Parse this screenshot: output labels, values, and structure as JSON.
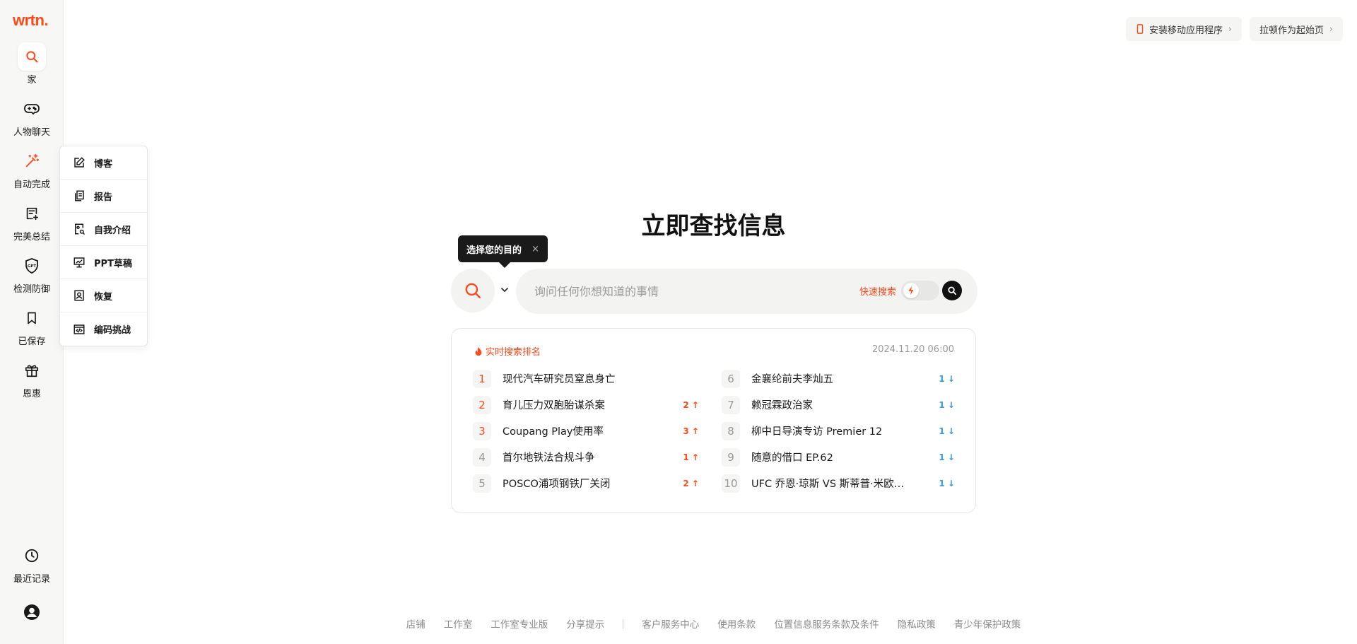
{
  "logo": "wrtn.",
  "sidebar": {
    "items": [
      {
        "label": "家",
        "icon": "search-icon"
      },
      {
        "label": "人物聊天",
        "icon": "gamepad-icon"
      },
      {
        "label": "自动完成",
        "icon": "magic-wand-icon"
      },
      {
        "label": "完美总结",
        "icon": "document-plus-icon"
      },
      {
        "label": "检测防御",
        "icon": "gpt-shield-icon"
      },
      {
        "label": "已保存",
        "icon": "bookmark-icon"
      },
      {
        "label": "恩惠",
        "icon": "gift-icon"
      }
    ],
    "recent_label": "最近记录",
    "recent_icon": "clock-icon",
    "profile_icon": "user-circle-icon"
  },
  "dropdown": {
    "items": [
      {
        "label": "博客",
        "icon": "edit-icon"
      },
      {
        "label": "报告",
        "icon": "copy-icon"
      },
      {
        "label": "自我介绍",
        "icon": "profile-doc-icon"
      },
      {
        "label": "PPT草稿",
        "icon": "presentation-icon"
      },
      {
        "label": "恢复",
        "icon": "id-card-icon"
      },
      {
        "label": "编码挑战",
        "icon": "code-window-icon"
      }
    ]
  },
  "top_buttons": {
    "install_app": "安装移动应用程序",
    "set_homepage": "拉顿作为起始页"
  },
  "main": {
    "title": "立即查找信息",
    "tooltip": "选择您的目的",
    "tooltip_close": "×",
    "search_placeholder": "询问任何你想知道的事情",
    "quick_search_label": "快速搜索"
  },
  "ranking": {
    "title": "实时搜索排名",
    "date": "2024.11.20 06:00",
    "left": [
      {
        "rank": "1",
        "title": "现代汽车研究员窒息身亡",
        "change": "",
        "dir": ""
      },
      {
        "rank": "2",
        "title": "育儿压力双胞胎谋杀案",
        "change": "2 ↑",
        "dir": "up"
      },
      {
        "rank": "3",
        "title": "Coupang Play使用率",
        "change": "3 ↑",
        "dir": "up"
      },
      {
        "rank": "4",
        "title": "首尔地铁法合规斗争",
        "change": "1 ↑",
        "dir": "up"
      },
      {
        "rank": "5",
        "title": "POSCO浦项钢铁厂关闭",
        "change": "2 ↑",
        "dir": "up"
      }
    ],
    "right": [
      {
        "rank": "6",
        "title": "金襄纶前夫李灿五",
        "change": "1 ↓",
        "dir": "down"
      },
      {
        "rank": "7",
        "title": "赖冠霖政治家",
        "change": "1 ↓",
        "dir": "down"
      },
      {
        "rank": "8",
        "title": "柳中日导演专访 Premier 12",
        "change": "1 ↓",
        "dir": "down"
      },
      {
        "rank": "9",
        "title": "随意的借口 EP.62",
        "change": "1 ↓",
        "dir": "down"
      },
      {
        "rank": "10",
        "title": "UFC 乔恩·琼斯 VS 斯蒂普·米欧西...",
        "change": "1 ↓",
        "dir": "down"
      }
    ]
  },
  "footer": {
    "group1": [
      "店铺",
      "工作室",
      "工作室专业版",
      "分享提示"
    ],
    "group2": [
      "客户服务中心",
      "使用条款",
      "位置信息服务条款及条件",
      "隐私政策",
      "青少年保护政策"
    ]
  },
  "colors": {
    "accent": "#ff4a1c",
    "down": "#3a9be0"
  }
}
